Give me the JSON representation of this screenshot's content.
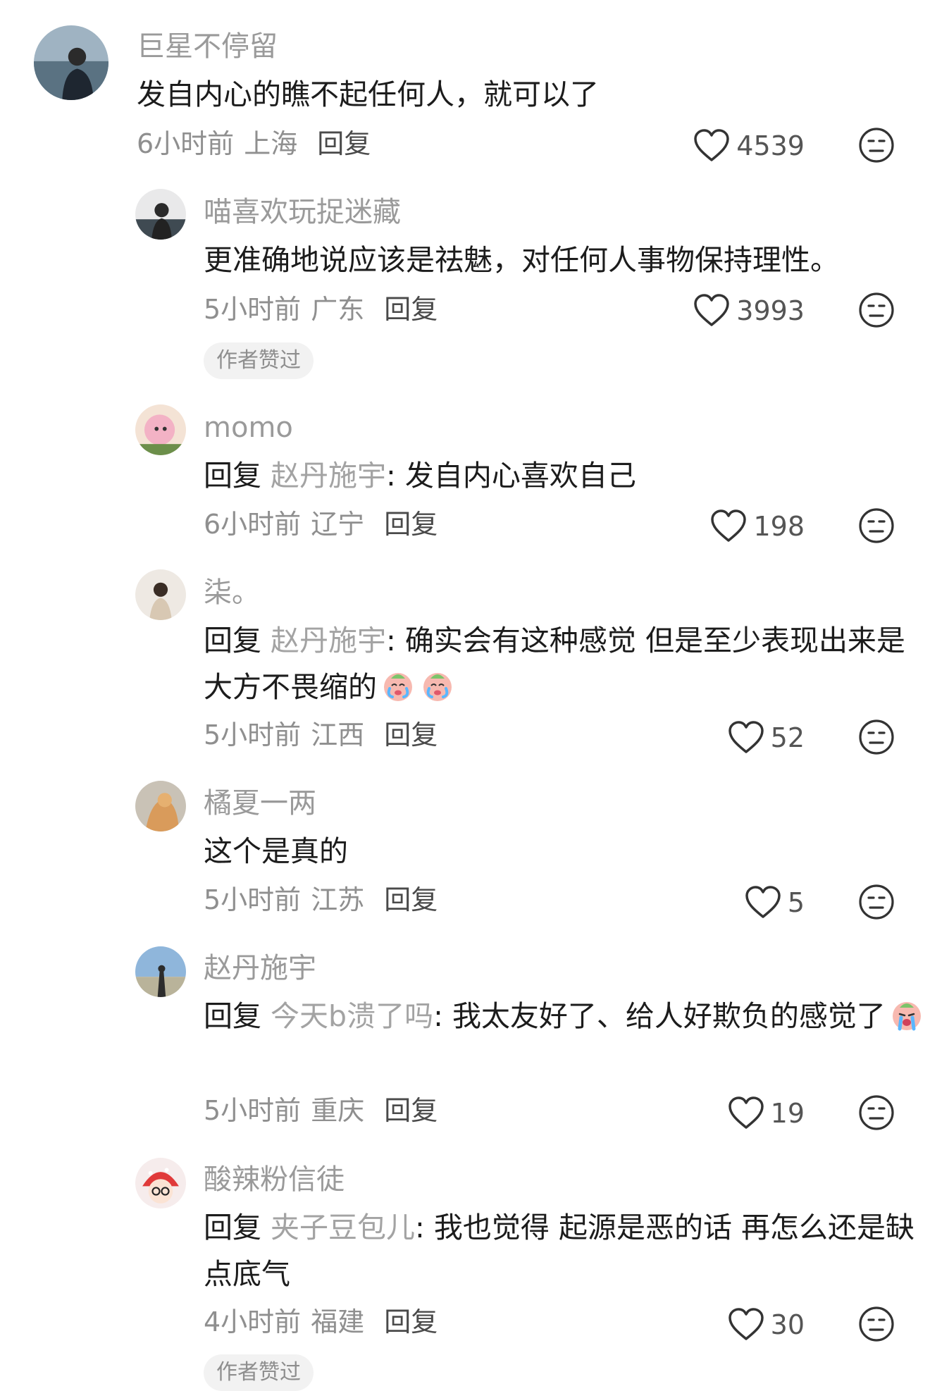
{
  "comments": [
    {
      "username": "巨星不停留",
      "prefix": "",
      "target": "",
      "sep": "",
      "text": "发自内心的瞧不起任何人，就可以了",
      "time": "6小时前",
      "location": "上海",
      "reply": "回复",
      "likes": "4539"
    },
    {
      "username": "喵喜欢玩捉迷藏",
      "prefix": "",
      "target": "",
      "sep": "",
      "text": "更准确地说应该是祛魅，对任何人事物保持理性。",
      "time": "5小时前",
      "location": "广东",
      "reply": "回复",
      "likes": "3993",
      "badge": "作者赞过"
    },
    {
      "username": "momo",
      "prefix": "回复",
      "target": "赵丹施宇",
      "sep": ": ",
      "text": "发自内心喜欢自己",
      "time": "6小时前",
      "location": "辽宁",
      "reply": "回复",
      "likes": "198"
    },
    {
      "username": "柒。",
      "prefix": "回复",
      "target": "赵丹施宇",
      "sep": ": ",
      "text": "确实会有这种感觉  但是至少表现出来是大方不畏缩的",
      "time": "5小时前",
      "location": "江西",
      "reply": "回复",
      "likes": "52"
    },
    {
      "username": "橘夏一两",
      "prefix": "",
      "target": "",
      "sep": "",
      "text": "这个是真的",
      "time": "5小时前",
      "location": "江苏",
      "reply": "回复",
      "likes": "5"
    },
    {
      "username": "赵丹施宇",
      "prefix": "回复",
      "target": "今天b溃了吗",
      "sep": ": ",
      "text": "我太友好了、给人好欺负的感觉了",
      "time": "5小时前",
      "location": "重庆",
      "reply": "回复",
      "likes": "19"
    },
    {
      "username": "酸辣粉信徒",
      "prefix": "回复",
      "target": "夹子豆包儿",
      "sep": ": ",
      "text": "我也觉得 起源是恶的话 再怎么还是缺点底气",
      "time": "4小时前",
      "location": "福建",
      "reply": "回复",
      "likes": "30",
      "badge": "作者赞过"
    }
  ],
  "colors": {
    "username": "#9a9a9a",
    "content": "#1c1c1c",
    "meta": "#8f8f8f",
    "badge_bg": "#f2f2f2"
  },
  "icons": {
    "like": "heart-icon",
    "dislike": "dislike-face-icon",
    "emoji_crying": "crying-face-emoji",
    "emoji_loud_crying": "loudly-crying-face-emoji"
  }
}
